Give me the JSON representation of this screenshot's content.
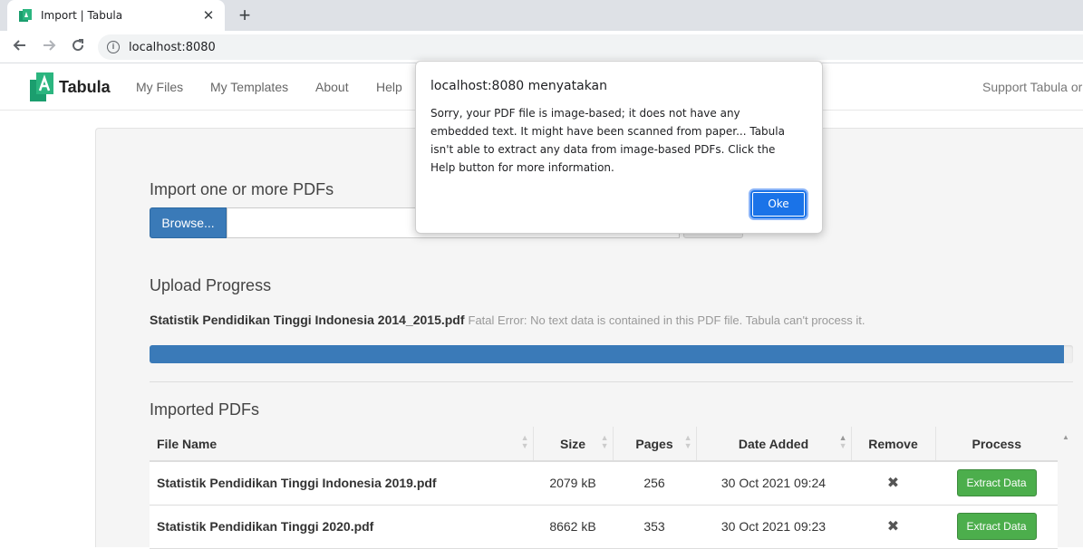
{
  "browser": {
    "tab_title": "Import | Tabula",
    "tab_close": "✕",
    "new_tab": "+",
    "url": "localhost:8080"
  },
  "navbar": {
    "brand": "Tabula",
    "items": [
      "My Files",
      "My Templates",
      "About",
      "Help"
    ],
    "right_text": "Support Tabula or"
  },
  "import": {
    "heading": "Import one or more PDFs",
    "browse_label": "Browse..."
  },
  "upload": {
    "heading": "Upload Progress",
    "file_name": "Statistik Pendidikan Tinggi Indonesia 2014_2015.pdf",
    "error": "Fatal Error: No text data is contained in this PDF file. Tabula can't process it.",
    "progress_fraction": 0.99
  },
  "imported": {
    "heading": "Imported PDFs",
    "columns": [
      "File Name",
      "Size",
      "Pages",
      "Date Added",
      "Remove",
      "Process"
    ],
    "rows": [
      {
        "file": "Statistik Pendidikan Tinggi Indonesia 2019.pdf",
        "size": "2079 kB",
        "pages": "256",
        "date": "30 Oct 2021 09:24",
        "remove": "✖",
        "action": "Extract Data"
      },
      {
        "file": "Statistik Pendidikan Tinggi 2020.pdf",
        "size": "8662 kB",
        "pages": "353",
        "date": "30 Oct 2021 09:23",
        "remove": "✖",
        "action": "Extract Data"
      }
    ]
  },
  "dialog": {
    "title": "localhost:8080 menyatakan",
    "message": "Sorry, your PDF file is image-based; it does not have any embedded text. It might have been scanned from paper... Tabula isn't able to extract any data from image-based PDFs. Click the Help button for more information.",
    "ok_label": "Oke"
  },
  "colors": {
    "primary": "#3a7ab8",
    "success": "#4cae4c",
    "dialog_button": "#1a73e8",
    "brand_green": "#1b9e6e"
  }
}
